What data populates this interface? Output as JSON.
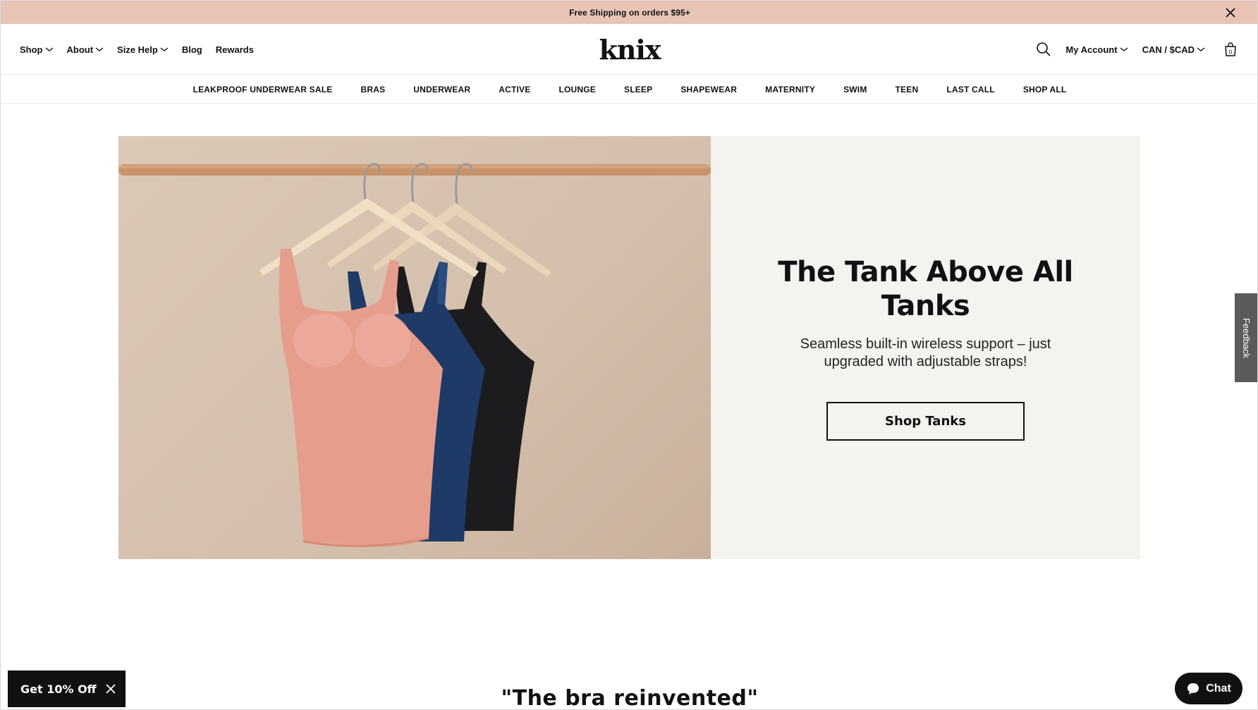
{
  "announcement": {
    "text": "Free Shipping on orders $95+",
    "close_icon": "close-icon"
  },
  "header": {
    "logo": "knix",
    "nav_left": [
      {
        "label": "Shop",
        "has_dropdown": true
      },
      {
        "label": "About",
        "has_dropdown": true
      },
      {
        "label": "Size Help",
        "has_dropdown": true
      },
      {
        "label": "Blog",
        "has_dropdown": false
      },
      {
        "label": "Rewards",
        "has_dropdown": false
      }
    ],
    "nav_right": {
      "search_icon": "search-icon",
      "account_label": "My Account",
      "currency_label": "CAN / $CAD",
      "cart_icon": "shopping-bag-icon",
      "cart_count": "0"
    }
  },
  "categories": [
    "LEAKPROOF UNDERWEAR SALE",
    "BRAS",
    "UNDERWEAR",
    "ACTIVE",
    "LOUNGE",
    "SLEEP",
    "SHAPEWEAR",
    "MATERNITY",
    "SWIM",
    "TEEN",
    "LAST CALL",
    "SHOP ALL"
  ],
  "hero": {
    "title": "The Tank Above All Tanks",
    "subtitle": "Seamless built-in wireless support – just upgraded with adjustable straps!",
    "button_label": "Shop Tanks"
  },
  "section_quote": "\"The bra reinvented\"",
  "floating": {
    "discount_label": "Get 10% Off",
    "chat_label": "Chat",
    "feedback_label": "Feedback"
  },
  "colors": {
    "announcement_bg": "#e8c4b6",
    "hero_panel_bg": "#f4f3ef",
    "tank_pink": "#e79d8c",
    "tank_navy": "#1e3a66",
    "tank_black": "#1c1c1e"
  }
}
